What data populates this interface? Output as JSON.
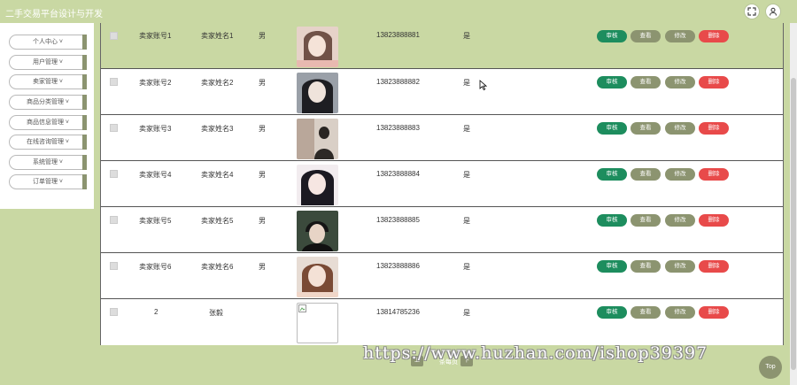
{
  "header": {
    "title": "二手交易平台设计与开发"
  },
  "sidebar": {
    "items": [
      {
        "label": "个人中心 ˅"
      },
      {
        "label": "用户管理 ˅"
      },
      {
        "label": "卖家管理 ˅"
      },
      {
        "label": "商品分类管理 ˅"
      },
      {
        "label": "商品信息管理 ˅"
      },
      {
        "label": "在线咨询管理 ˅"
      },
      {
        "label": "系统管理 ˅"
      },
      {
        "label": "订单管理 ˅"
      }
    ]
  },
  "actions": {
    "audit": "审核",
    "view": "查看",
    "edit": "修改",
    "delete": "删除"
  },
  "rows": [
    {
      "account": "卖家账号1",
      "name": "卖家姓名1",
      "gender": "男",
      "phone": "13823888881",
      "flag": "是"
    },
    {
      "account": "卖家账号2",
      "name": "卖家姓名2",
      "gender": "男",
      "phone": "13823888882",
      "flag": "是"
    },
    {
      "account": "卖家账号3",
      "name": "卖家姓名3",
      "gender": "男",
      "phone": "13823888883",
      "flag": "是"
    },
    {
      "account": "卖家账号4",
      "name": "卖家姓名4",
      "gender": "男",
      "phone": "13823888884",
      "flag": "是"
    },
    {
      "account": "卖家账号5",
      "name": "卖家姓名5",
      "gender": "男",
      "phone": "13823888885",
      "flag": "是"
    },
    {
      "account": "卖家账号6",
      "name": "卖家姓名6",
      "gender": "男",
      "phone": "13823888886",
      "flag": "是"
    },
    {
      "account": "2",
      "name": "张毅",
      "gender": "",
      "phone": "13814785236",
      "flag": "是"
    }
  ],
  "pager": {
    "prev": "上",
    "text": "条每页",
    "next": "下"
  },
  "watermark": "https://www.huzhan.com/ishop39397",
  "top_button": "Top",
  "colors": {
    "accent": "#c9d8a3",
    "audit": "#1d8d5e",
    "neutral": "#8c9470",
    "danger": "#e84a4a"
  }
}
